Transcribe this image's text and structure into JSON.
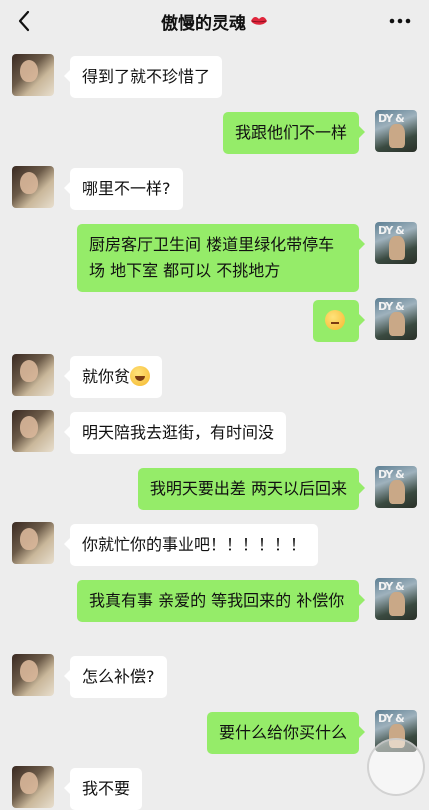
{
  "header": {
    "title": "傲慢的灵魂",
    "title_icon": "red-lips-emoji",
    "back_icon": "chevron-left-icon",
    "more_icon": "more-dots-icon"
  },
  "messages": [
    {
      "from": "them",
      "text": "得到了就不珍惜了"
    },
    {
      "from": "me",
      "text": "我跟他们不一样"
    },
    {
      "from": "them",
      "text": "哪里不一样?"
    },
    {
      "from": "me",
      "text": "厨房客厅卫生间 楼道里绿化带停车场  地下室 都可以  不挑地方"
    },
    {
      "from": "me",
      "text": "",
      "emoji": "thinking-emoji"
    },
    {
      "from": "them",
      "text": "就你贫",
      "emoji": "laughing-emoji"
    },
    {
      "from": "them",
      "text": "明天陪我去逛街，有时间没"
    },
    {
      "from": "me",
      "text": "我明天要出差 两天以后回来"
    },
    {
      "from": "them",
      "text": "你就忙你的事业吧！！！！！！"
    },
    {
      "from": "me",
      "text": "我真有事  亲爱的  等我回来的 补偿你"
    },
    {
      "from": "them",
      "text": "怎么补偿?"
    },
    {
      "from": "me",
      "text": "要什么给你买什么"
    },
    {
      "from": "them",
      "text": "我不要"
    }
  ],
  "avatar_me_text": "DY &",
  "colors": {
    "background": "#ededed",
    "bubble_me": "#95ec69",
    "bubble_them": "#ffffff"
  }
}
